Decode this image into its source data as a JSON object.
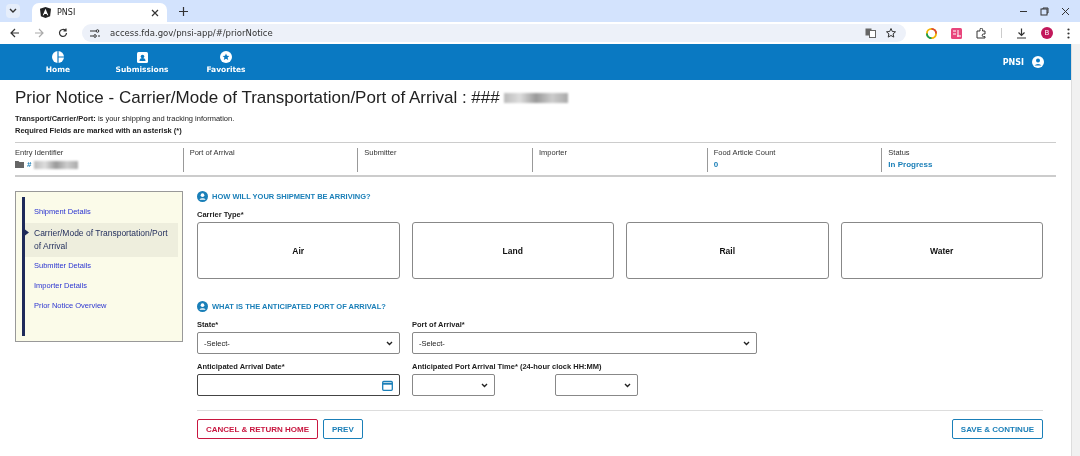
{
  "browser": {
    "tab_title": "PNSI",
    "url": "access.fda.gov/pnsi-app/#/priorNotice",
    "profile_initial": "B"
  },
  "header": {
    "nav": [
      {
        "label": "Home"
      },
      {
        "label": "Submissions"
      },
      {
        "label": "Favorites"
      }
    ],
    "app_name": "PNSI"
  },
  "page": {
    "title": "Prior Notice - Carrier/Mode of Transportation/Port of Arrival : ###",
    "title_redacted": true,
    "intro": "**Transport/Carrier/Port:** is your shipping and tracking information.",
    "required_note": "Required Fields are marked with an asterisk (*)"
  },
  "summary": [
    {
      "label": "Entry Identifier",
      "value": "#",
      "redacted": true,
      "folder": true
    },
    {
      "label": "Port of Arrival"
    },
    {
      "label": "Submitter"
    },
    {
      "label": "Importer"
    },
    {
      "label": "Food Article Count",
      "value": "0"
    },
    {
      "label": "Status",
      "value": "In Progress"
    }
  ],
  "sidebar": {
    "items": [
      {
        "label": "Shipment Details",
        "selected": false
      },
      {
        "label": "Carrier/Mode of Transportation/Port of Arrival",
        "selected": true
      },
      {
        "label": "Submitter Details",
        "selected": false
      },
      {
        "label": "Importer Details",
        "selected": false
      },
      {
        "label": "Prior Notice Overview",
        "selected": false
      }
    ]
  },
  "carrier_section": {
    "heading": "HOW WILL YOUR SHIPMENT BE ARRIVING?",
    "label": "Carrier Type*",
    "options": [
      {
        "label": "Air",
        "selected": false
      },
      {
        "label": "Land",
        "selected": false
      },
      {
        "label": "Rail",
        "selected": false
      },
      {
        "label": "Water",
        "selected": false
      }
    ]
  },
  "port_section": {
    "heading": "WHAT IS THE ANTICIPATED PORT OF ARRIVAL?",
    "state": {
      "label": "State*",
      "value": "-Select-"
    },
    "port": {
      "label": "Port of Arrival*",
      "value": "-Select-"
    },
    "date": {
      "label": "Anticipated Arrival Date*"
    },
    "time": {
      "label": "Anticipated Port Arrival Time* (24-hour clock HH:MM)"
    }
  },
  "buttons": {
    "cancel": "CANCEL & RETURN HOME",
    "prev": "PREV",
    "save": "SAVE & CONTINUE"
  }
}
